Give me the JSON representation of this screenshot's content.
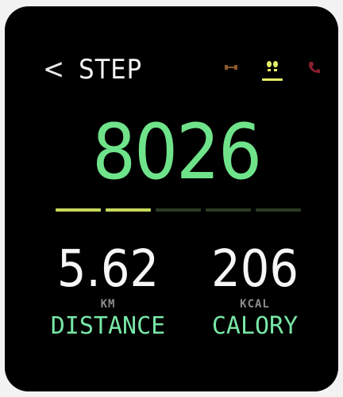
{
  "header": {
    "back_glyph": "<",
    "title": "STEP",
    "icons": [
      {
        "name": "sleep-icon",
        "color": "#8a5a2a"
      },
      {
        "name": "steps-icon",
        "color": "#e8f06a",
        "active": true
      },
      {
        "name": "phone-icon",
        "color": "#8a2030"
      }
    ]
  },
  "main": {
    "steps": "8026"
  },
  "progress": {
    "fraction": 0.4,
    "segments": 5,
    "filled_color": "#c8d85a",
    "empty_color": "#2c3b22"
  },
  "metrics": {
    "distance": {
      "value": "5.62",
      "unit": "KM",
      "label": "DISTANCE"
    },
    "calory": {
      "value": "206",
      "unit": "KCAL",
      "label": "CALORY"
    }
  },
  "colors": {
    "accent_green": "#6fe38a",
    "label_green": "#78e6a7",
    "background": "#000000"
  }
}
